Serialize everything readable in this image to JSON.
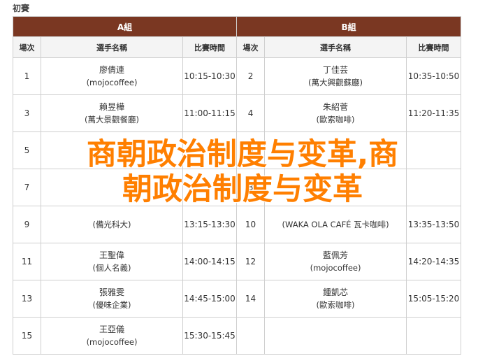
{
  "caption": "初賽",
  "groups": [
    {
      "label": "A組"
    },
    {
      "label": "B組"
    }
  ],
  "columns": {
    "slot": "場次",
    "player": "選手名稱",
    "time": "比賽時間"
  },
  "rows": [
    {
      "a": {
        "slot": "1",
        "name": "廖倩連",
        "team": "(mojocoffee)",
        "time": "10:15-10:30"
      },
      "b": {
        "slot": "2",
        "name": "丁佳芸",
        "team": "(萬大興觀蘇廳)",
        "time": "10:35-10:50"
      }
    },
    {
      "a": {
        "slot": "3",
        "name": "賴昱樺",
        "team": "(萬大景觀餐廳)",
        "time": "11:00-11:15"
      },
      "b": {
        "slot": "4",
        "name": "朱紹菅",
        "team": "(歐索咖啡)",
        "time": "11:20-11:35"
      }
    },
    {
      "a": {
        "slot": "5",
        "name": "",
        "team": "",
        "time": ""
      },
      "b": {
        "slot": "6",
        "name": "",
        "team": "",
        "time": ""
      }
    },
    {
      "a": {
        "slot": "7",
        "name": "",
        "team": "",
        "time": ""
      },
      "b": {
        "slot": "8",
        "name": "",
        "team": "",
        "time": ""
      }
    },
    {
      "a": {
        "slot": "9",
        "name": "",
        "team": "(備光科大)",
        "time": "13:15-13:30"
      },
      "b": {
        "slot": "10",
        "name": "",
        "team": "(WAKA OLA CAFÉ 瓦卡咖啡)",
        "time": "13:35-13:50"
      }
    },
    {
      "a": {
        "slot": "11",
        "name": "王聖偉",
        "team": "(個人名義)",
        "time": "14:00-14:15"
      },
      "b": {
        "slot": "12",
        "name": "藍佩芳",
        "team": "(mojocoffee)",
        "time": "14:20-14:35"
      }
    },
    {
      "a": {
        "slot": "13",
        "name": "張雅雯",
        "team": "(優味企業)",
        "time": "14:45-15:00"
      },
      "b": {
        "slot": "14",
        "name": "鍾凱芯",
        "team": "(歐索咖啡)",
        "time": "15:05-15:20"
      }
    },
    {
      "a": {
        "slot": "15",
        "name": "王亞儀",
        "team": "(mojocoffee)",
        "time": "15:30-15:45"
      },
      "b": {
        "slot": "",
        "name": "",
        "team": "",
        "time": ""
      }
    }
  ],
  "overlay": {
    "line1": "商朝政治制度与变革,商",
    "line2": "朝政治制度与变革"
  },
  "colors": {
    "header_bg": "#7a3722",
    "overlay_text": "#ff7f00"
  }
}
